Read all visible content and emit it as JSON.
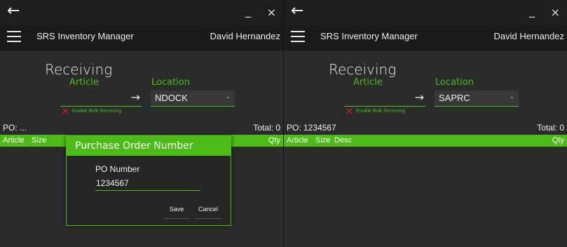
{
  "window_left": {
    "back_glyph": "←",
    "minimize_glyph": "_",
    "close_glyph": "×",
    "app_title": "SRS Inventory Manager",
    "user_name": "David Hernandez",
    "page_heading": "Receiving",
    "article_label": "Article",
    "article_go_glyph": "→",
    "location_label": "Location",
    "location_value": "NDOCK",
    "location_chevron": "⌄",
    "bulk_receiving_label": "Enable Bulk Receiving",
    "po_label": "PO: ...",
    "total_label": "Total: 0",
    "table_headers": {
      "article": "Article",
      "size": "Size",
      "qty": "Qty"
    },
    "dialog": {
      "title": "Purchase Order Number",
      "field_label": "PO Number",
      "field_value": "1234567",
      "save_label": "Save",
      "cancel_label": "Cancel"
    }
  },
  "window_right": {
    "back_glyph": "←",
    "minimize_glyph": "_",
    "close_glyph": "×",
    "app_title": "SRS Inventory Manager",
    "user_name": "David Hernandez",
    "page_heading": "Receiving",
    "article_label": "Article",
    "article_go_glyph": "→",
    "location_label": "Location",
    "location_value": "SAPRC",
    "location_chevron": "⌄",
    "bulk_receiving_label": "Enable Bulk Receiving",
    "po_label": "PO: 1234567",
    "total_label": "Total: 0",
    "table_headers": {
      "article": "Article",
      "size": "Size",
      "desc": "Desc",
      "qty": "Qty"
    }
  },
  "colors": {
    "accent": "#4cbb17",
    "error": "#e8141b",
    "background": "#2b2b2b",
    "titlebar": "#1e1e1e",
    "appbar": "#1a1a1a"
  }
}
